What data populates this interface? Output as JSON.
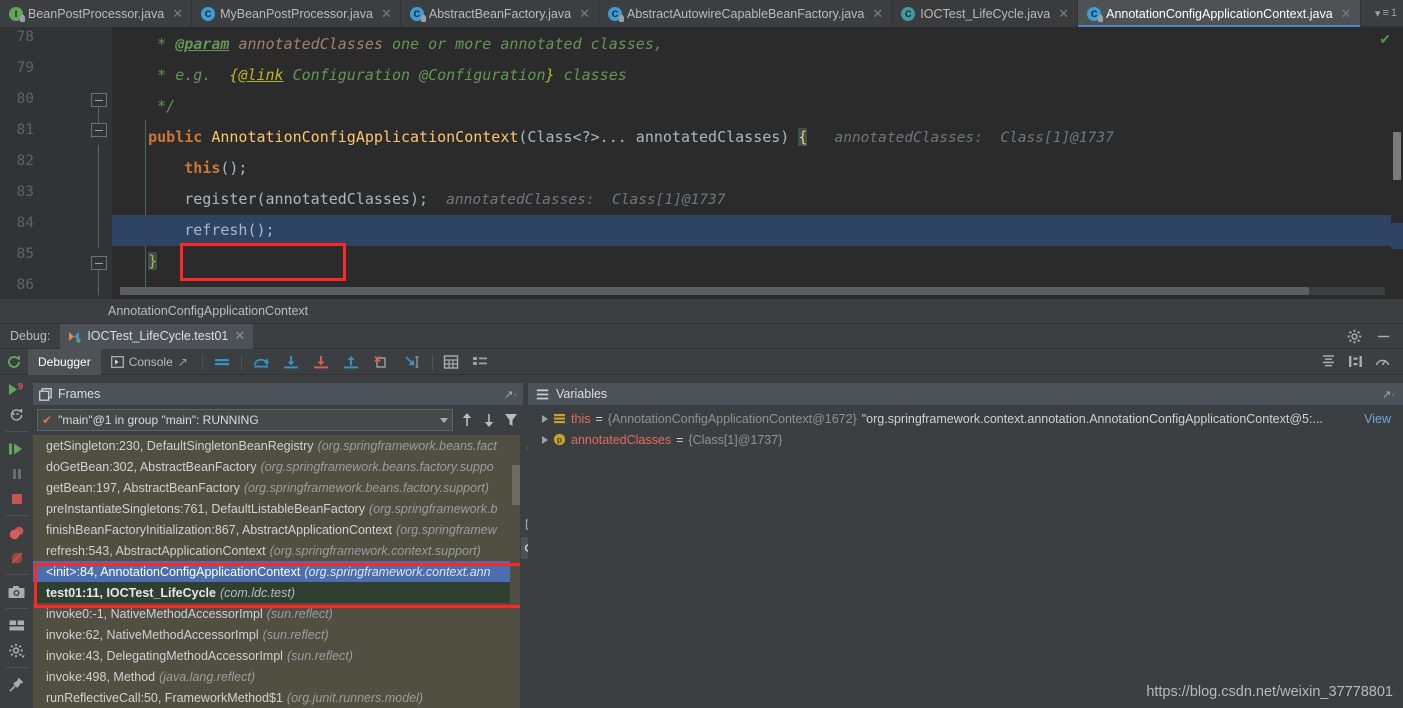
{
  "tabs": [
    {
      "label": "BeanPostProcessor.java",
      "icon": "interface-icon",
      "state": "inactive"
    },
    {
      "label": "MyBeanPostProcessor.java",
      "icon": "class-icon",
      "state": "inactive"
    },
    {
      "label": "AbstractBeanFactory.java",
      "icon": "abstract-class-icon",
      "state": "inactive"
    },
    {
      "label": "AbstractAutowireCapableBeanFactory.java",
      "icon": "abstract-class-icon",
      "state": "inactive"
    },
    {
      "label": "IOCTest_LifeCycle.java",
      "icon": "test-class-icon",
      "state": "inactive"
    },
    {
      "label": "AnnotationConfigApplicationContext.java",
      "icon": "class-icon",
      "state": "active"
    }
  ],
  "tabs_overflow": "1",
  "editor": {
    "lines": [
      {
        "number": "78",
        "kind": "javadoc"
      },
      {
        "number": "79",
        "kind": "javadoc"
      },
      {
        "number": "80",
        "kind": "javadoc_end"
      },
      {
        "number": "81",
        "kind": "signature"
      },
      {
        "number": "82",
        "kind": "this_call"
      },
      {
        "number": "83",
        "kind": "register_call"
      },
      {
        "number": "84",
        "kind": "refresh_call",
        "highlighted": true
      },
      {
        "number": "85",
        "kind": "close_brace"
      },
      {
        "number": "86",
        "kind": "blank"
      }
    ],
    "l78": {
      "star": "*",
      "tag": "@param",
      "arg": "annotatedClasses",
      "rest": "one or more annotated classes,"
    },
    "l79": {
      "star": "*",
      "eg": "e.g.",
      "open": "{",
      "link": "@link",
      "cfg": "Configuration",
      "cfg2": "@Configuration",
      "close": "}",
      "rest": "classes"
    },
    "l80": {
      "text": "*/"
    },
    "l81": {
      "kw": "public",
      "name": "AnnotationConfigApplicationContext",
      "params": "(Class<?>... annotatedClasses)",
      "brace": "{",
      "hint": "annotatedClasses:  Class[1]@1737"
    },
    "l82": {
      "kw": "this",
      "rest": "();"
    },
    "l83": {
      "call": "register",
      "args": "(annotatedClasses);",
      "hint": "annotatedClasses:  Class[1]@1737"
    },
    "l84": {
      "call": "refresh",
      "rest": "();"
    },
    "l85": {
      "text": "}"
    },
    "status_ok": "check-icon"
  },
  "breadcrumb": {
    "text": "AnnotationConfigApplicationContext"
  },
  "debug_header": {
    "label": "Debug:",
    "run_config": "IOCTest_LifeCycle.test01",
    "close": "close-icon",
    "settings": "gear-icon",
    "minimize": "minimize-icon"
  },
  "debug_toolbar": {
    "rerun": "rerun-icon",
    "tabs": [
      {
        "label": "Debugger",
        "icon": "debugger-icon",
        "selected": true
      },
      {
        "label": "Console",
        "icon": "console-icon",
        "selected": false
      }
    ],
    "actions": [
      {
        "name": "show-execution-point-icon"
      },
      {
        "name": "step-over-icon"
      },
      {
        "name": "step-into-icon"
      },
      {
        "name": "force-step-into-icon"
      },
      {
        "name": "step-out-icon"
      },
      {
        "name": "drop-frame-icon"
      },
      {
        "name": "run-to-cursor-icon"
      },
      {
        "name": "evaluate-expression-icon"
      },
      {
        "name": "watches-icon"
      }
    ],
    "right_actions": [
      {
        "name": "layout-settings-icon"
      },
      {
        "name": "restore-layout-icon"
      },
      {
        "name": "profiler-icon"
      }
    ]
  },
  "left_rail": [
    {
      "name": "rerun-debug-icon"
    },
    {
      "name": "rerun-failed-tests-icon"
    },
    {
      "name": "resume-program-icon"
    },
    {
      "name": "pause-program-icon"
    },
    {
      "name": "stop-icon"
    },
    {
      "name": "view-breakpoints-icon"
    },
    {
      "name": "mute-breakpoints-icon"
    },
    {
      "name": "screenshot-icon"
    },
    {
      "name": "layout-icon"
    },
    {
      "name": "settings-icon"
    },
    {
      "name": "pin-tab-icon"
    }
  ],
  "frames": {
    "title": "Frames",
    "thread": "\"main\"@1 in group \"main\": RUNNING",
    "thread_check": "check-icon",
    "buttons": [
      "up-arrow-icon",
      "down-arrow-icon",
      "filter-icon"
    ],
    "rows": [
      {
        "method": "getSingleton:230, DefaultSingletonBeanRegistry",
        "pkg": "(org.springframework.beans.fact",
        "state": "normal"
      },
      {
        "method": "doGetBean:302, AbstractBeanFactory",
        "pkg": "(org.springframework.beans.factory.suppo",
        "state": "normal"
      },
      {
        "method": "getBean:197, AbstractBeanFactory",
        "pkg": "(org.springframework.beans.factory.support)",
        "state": "normal"
      },
      {
        "method": "preInstantiateSingletons:761, DefaultListableBeanFactory",
        "pkg": "(org.springframework.b",
        "state": "normal"
      },
      {
        "method": "finishBeanFactoryInitialization:867, AbstractApplicationContext",
        "pkg": "(org.springframew",
        "state": "normal"
      },
      {
        "method": "refresh:543, AbstractApplicationContext",
        "pkg": "(org.springframework.context.support)",
        "state": "normal"
      },
      {
        "method": "<init>:84, AnnotationConfigApplicationContext",
        "pkg": "(org.springframework.context.ann",
        "state": "selected"
      },
      {
        "method": "test01:11, IOCTest_LifeCycle",
        "pkg": "(com.ldc.test)",
        "state": "green"
      },
      {
        "method": "invoke0:-1, NativeMethodAccessorImpl",
        "pkg": "(sun.reflect)",
        "state": "normal"
      },
      {
        "method": "invoke:62, NativeMethodAccessorImpl",
        "pkg": "(sun.reflect)",
        "state": "normal"
      },
      {
        "method": "invoke:43, DelegatingMethodAccessorImpl",
        "pkg": "(sun.reflect)",
        "state": "normal"
      },
      {
        "method": "invoke:498, Method",
        "pkg": "(java.lang.reflect)",
        "state": "normal"
      },
      {
        "method": "runReflectiveCall:50, FrameworkMethod$1",
        "pkg": "(org.junit.runners.model)",
        "state": "normal"
      }
    ]
  },
  "mini_toolbar": [
    "collapse-icon",
    "scroll-up-icon",
    "scroll-down-icon",
    "copy-stack-icon",
    "settings-glasses-icon"
  ],
  "variables": {
    "title": "Variables",
    "icon": "variables-icon",
    "rows": [
      {
        "name": "this",
        "icon": "field-icon",
        "eq": "=",
        "value": "{AnnotationConfigApplicationContext@1672}",
        "string": "\"org.springframework.context.annotation.AnnotationConfigApplicationContext@5:...",
        "view": "View"
      },
      {
        "name": "annotatedClasses",
        "icon": "parameter-icon",
        "eq": "=",
        "value": "{Class[1]@1737}",
        "string": "",
        "view": ""
      }
    ]
  },
  "watermark": "https://blog.csdn.net/weixin_37778801",
  "colors": {
    "accent": "#4b6eaf",
    "annotation_red": "#ff2626",
    "editor_bg": "#2b2b2b",
    "panel_bg": "#3c3f41",
    "frames_bg": "#514f42",
    "green_frame": "#2f4032"
  }
}
